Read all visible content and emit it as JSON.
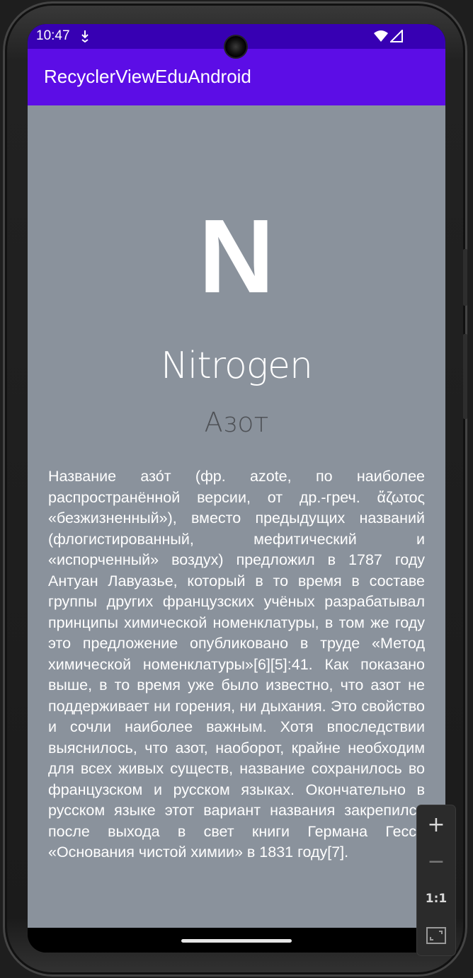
{
  "status_bar": {
    "time": "10:47",
    "download_icon": "download-icon",
    "wifi_icon": "wifi-icon",
    "signal_icon": "signal-icon",
    "color": "#3700b3"
  },
  "app_bar": {
    "title": "RecyclerViewEduAndroid",
    "color": "#5c0de6"
  },
  "element": {
    "symbol": "N",
    "name": "Nitrogen",
    "name_ru": "Азот",
    "background_color": "#8a929c",
    "description": "Название азо́т (фр. azote, по наиболее распространённой версии, от др.-греч. ἄζωτος «безжизненный»), вместо предыдущих названий (флогистированный, мефитический и «испорченный» воздух) предложил в 1787 году Антуан Лавуазье, который в то время в составе группы других французских учёных разрабатывал принципы химической номенклатуры, в том же году это предложение опубликовано в труде «Метод химической номенклатуры»[6][5]:41. Как показано выше, в то время уже было известно, что азот не поддерживает ни горения, ни дыхания. Это свойство и сочли наиболее важным. Хотя впоследствии выяснилось, что азот, наоборот, крайне необходим для всех живых существ, название сохранилось во французском и русском языках. Окончательно в русском языке этот вариант названия закрепился после выхода в свет книги Германа Гесса «Основания чистой химии» в 1831 году[7]."
  },
  "zoom_controls": {
    "zoom_in": "+",
    "zoom_out": "−",
    "reset": "1:1",
    "fit_icon": "fit-screen-icon"
  }
}
